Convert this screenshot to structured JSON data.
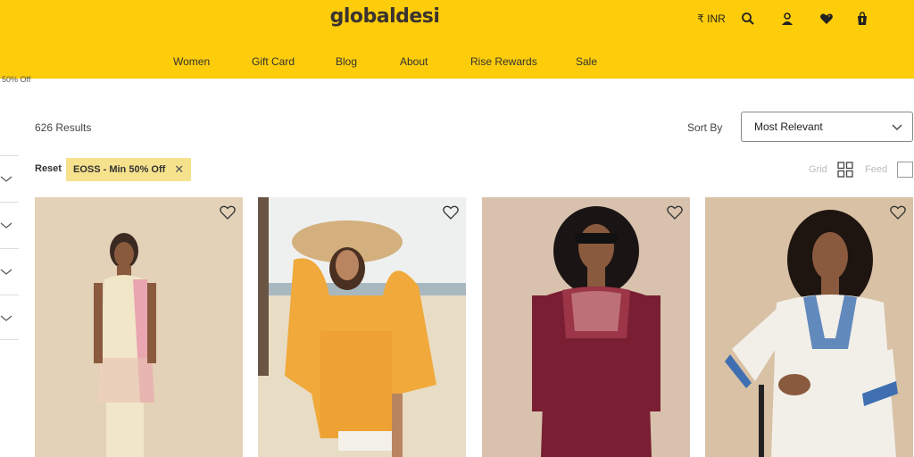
{
  "header": {
    "logo": "globaldesi",
    "currency": "₹ INR",
    "icons": [
      "search-icon",
      "user-icon",
      "wishlist-heart-icon",
      "shopping-bag-icon"
    ],
    "bg_color": "#fdcc0a"
  },
  "nav": {
    "items": [
      {
        "label": "Women"
      },
      {
        "label": "Gift Card"
      },
      {
        "label": "Blog"
      },
      {
        "label": "About"
      },
      {
        "label": "Rise Rewards"
      },
      {
        "label": "Sale"
      }
    ]
  },
  "offstrip": "50% Off",
  "listing": {
    "results": "626 Results",
    "sort_label": "Sort By",
    "sort_value": "Most Relevant",
    "reset_label": "Reset",
    "filter_chip": "EOSS - Min 50% Off",
    "view_grid_label": "Grid",
    "view_feed_label": "Feed"
  },
  "sidebar": {
    "filters": [
      {
        "icon": "chevron-down-icon"
      },
      {
        "icon": "chevron-down-icon"
      },
      {
        "icon": "chevron-down-icon"
      },
      {
        "icon": "chevron-down-icon"
      }
    ]
  },
  "products": [
    {
      "image": "woman-cream-embroidered-kurta",
      "bg": "#e3d2b7",
      "wishlist_icon": "heart-outline-icon"
    },
    {
      "image": "woman-yellow-print-top-beach-hat",
      "bg": "#d9d2c4",
      "wishlist_icon": "heart-outline-icon"
    },
    {
      "image": "woman-maroon-embroidered-top-sunglasses",
      "bg": "#d8c2ad",
      "wishlist_icon": "heart-outline-icon"
    },
    {
      "image": "woman-white-blue-embroidered-kurta",
      "bg": "#d9c1a5",
      "wishlist_icon": "heart-outline-icon"
    }
  ]
}
